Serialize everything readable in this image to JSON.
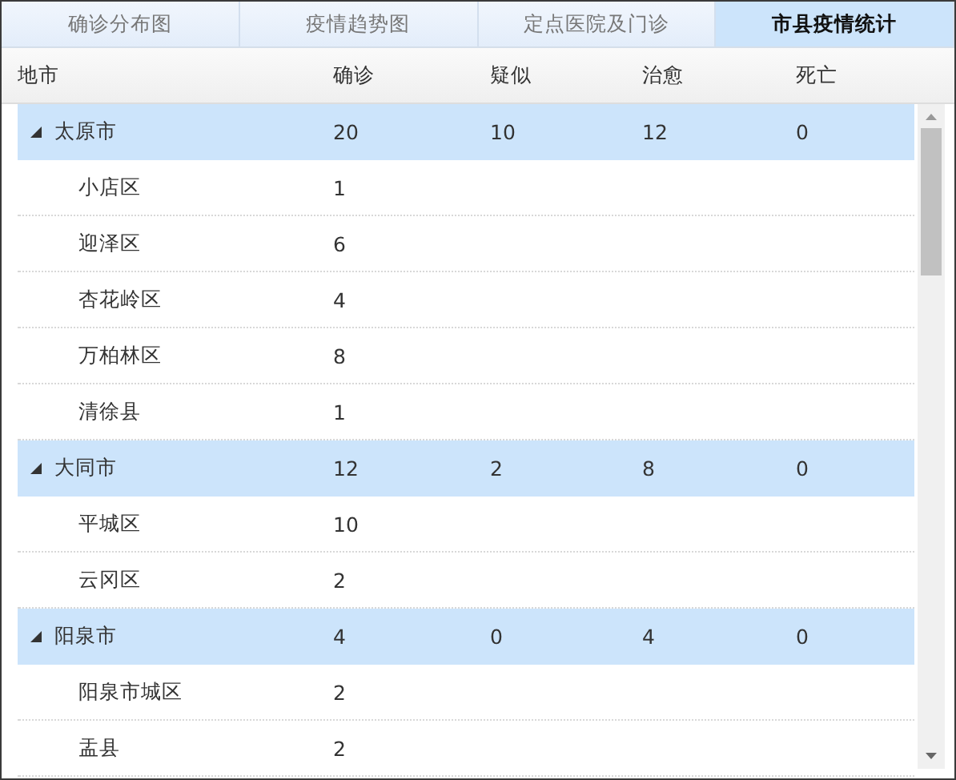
{
  "tabs": [
    {
      "label": "确诊分布图",
      "selected": false
    },
    {
      "label": "疫情趋势图",
      "selected": false
    },
    {
      "label": "定点医院及门诊",
      "selected": false
    },
    {
      "label": "市县疫情统计",
      "selected": true
    }
  ],
  "table": {
    "columns": [
      "地市",
      "确诊",
      "疑似",
      "治愈",
      "死亡"
    ],
    "rows": [
      {
        "cells": [
          "太原市",
          "20",
          "10",
          "12",
          "0"
        ],
        "expanded": true,
        "children": [
          {
            "cells": [
              "小店区",
              "1"
            ]
          },
          {
            "cells": [
              "迎泽区",
              "6"
            ]
          },
          {
            "cells": [
              "杏花岭区",
              "4"
            ]
          },
          {
            "cells": [
              "万柏林区",
              "8"
            ]
          },
          {
            "cells": [
              "清徐县",
              "1"
            ]
          }
        ]
      },
      {
        "cells": [
          "大同市",
          "12",
          "2",
          "8",
          "0"
        ],
        "expanded": true,
        "children": [
          {
            "cells": [
              "平城区",
              "10"
            ]
          },
          {
            "cells": [
              "云冈区",
              "2"
            ]
          }
        ]
      },
      {
        "cells": [
          "阳泉市",
          "4",
          "0",
          "4",
          "0"
        ],
        "expanded": true,
        "children": [
          {
            "cells": [
              "阳泉市城区",
              "2"
            ]
          },
          {
            "cells": [
              "盂县",
              "2"
            ]
          }
        ]
      }
    ]
  }
}
